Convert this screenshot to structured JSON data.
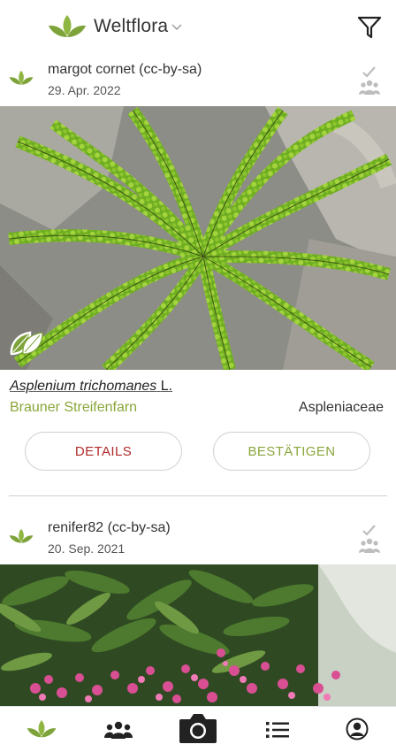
{
  "header": {
    "title": "Weltflora",
    "logo_icon": "plant-leaves-icon",
    "dropdown_icon": "chevron-down-icon",
    "filter_icon": "filter-icon"
  },
  "observations": [
    {
      "user": "margot cornet (cc-by-sa)",
      "date": "29. Apr. 2022",
      "scientific_name": "Asplenium trichomanes",
      "author": "L.",
      "common_name": "Brauner Streifenfarn",
      "family": "Aspleniaceae",
      "details_label": "DETAILS",
      "confirm_label": "BESTÄTIGEN",
      "status_icon": "community-check-icon",
      "badge_icon": "leaf-organ-badge-icon"
    },
    {
      "user": "renifer82 (cc-by-sa)",
      "date": "20. Sep. 2021",
      "status_icon": "community-check-icon"
    }
  ],
  "tabbar": {
    "tabs": [
      {
        "icon": "plant-leaves-icon",
        "active": true
      },
      {
        "icon": "people-icon",
        "active": false
      },
      {
        "icon": "camera-icon",
        "active": false
      },
      {
        "icon": "list-icon",
        "active": false
      },
      {
        "icon": "profile-icon",
        "active": false
      }
    ]
  },
  "colors": {
    "accent_green": "#8aa63a",
    "details_red": "#b02a2a",
    "divider": "#cfcfcf"
  }
}
